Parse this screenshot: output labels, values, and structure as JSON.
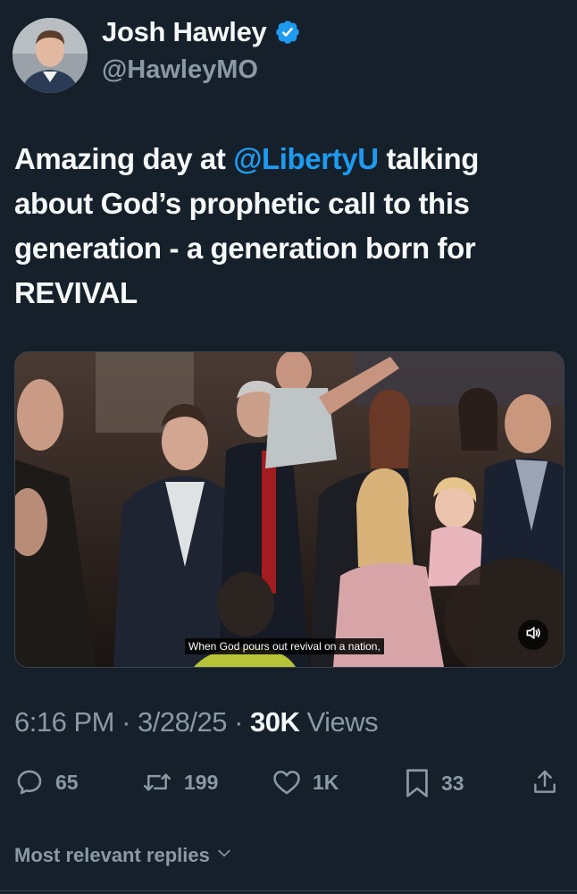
{
  "author": {
    "display_name": "Josh Hawley",
    "handle": "@HawleyMO",
    "verified_icon": "verified-badge-icon",
    "verified_color": "#1d9bf0"
  },
  "tweet": {
    "text_part1": "Amazing day at ",
    "mention": "@LibertyU",
    "text_part2": " talking about God’s prophetic call to this generation - a generation born for REVIVAL"
  },
  "media": {
    "caption": "When God pours out revival on a nation,",
    "sound_icon": "speaker-muted-icon"
  },
  "meta": {
    "time": "6:16 PM",
    "date": "3/28/25",
    "separator": "·",
    "views_count": "30K",
    "views_label": "Views"
  },
  "actions": {
    "replies": "65",
    "reposts": "199",
    "likes": "1K",
    "bookmarks": "33"
  },
  "replies_sort": {
    "label": "Most relevant replies"
  },
  "colors": {
    "background": "#15202b",
    "accent": "#1d9bf0",
    "secondary_text": "#8b98a5",
    "primary_text": "#f7f9f9"
  }
}
